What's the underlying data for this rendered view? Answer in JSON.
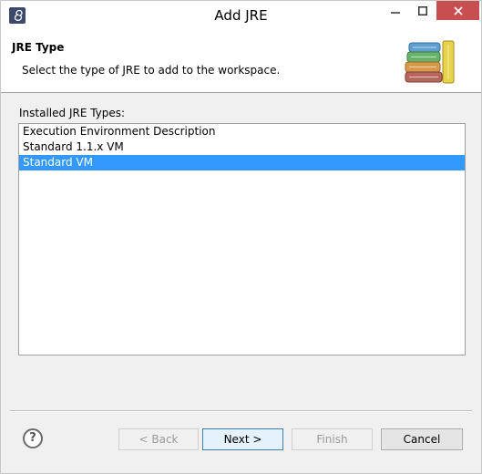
{
  "window": {
    "title": "Add JRE",
    "icon": "eclipse-app-icon",
    "controls": {
      "minimize": "minimize-icon",
      "maximize": "maximize-icon",
      "close": "close-icon"
    }
  },
  "header": {
    "title": "JRE Type",
    "description": "Select the type of JRE to add to the workspace.",
    "icon": "books-icon"
  },
  "jre_types": {
    "label": "Installed JRE Types:",
    "items": [
      {
        "label": "Execution Environment Description",
        "selected": false
      },
      {
        "label": "Standard 1.1.x VM",
        "selected": false
      },
      {
        "label": "Standard VM",
        "selected": true
      }
    ]
  },
  "buttons": {
    "help": "?",
    "back": "< Back",
    "next": "Next >",
    "finish": "Finish",
    "cancel": "Cancel"
  },
  "colors": {
    "selection": "#3399ff",
    "close_button": "#c74f50",
    "dialog_bg": "#f0f0f0"
  }
}
